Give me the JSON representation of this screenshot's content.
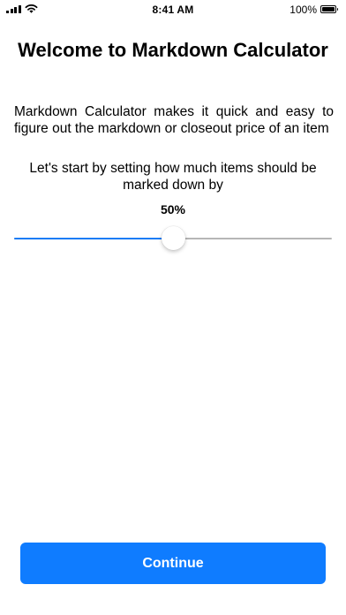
{
  "status_bar": {
    "time": "8:41 AM",
    "battery_percent": "100%",
    "battery_level": 1.0,
    "icons": [
      "cellular-signal-icon",
      "wifi-icon",
      "battery-icon"
    ]
  },
  "title": "Welcome to Markdown Calculator",
  "intro": "Markdown Calculator makes it quick and easy to figure out the markdown or closeout price of an item",
  "prompt": "Let's start by setting how much items should be marked down by",
  "markdown": {
    "display": "50%",
    "slider_value": 0.5
  },
  "continue_label": "Continue",
  "colors": {
    "accent": "#0f7cff",
    "slider_track_active": "#1b7cf5",
    "slider_track_inactive": "#b6b6b6",
    "text": "#000000",
    "background": "#ffffff"
  }
}
